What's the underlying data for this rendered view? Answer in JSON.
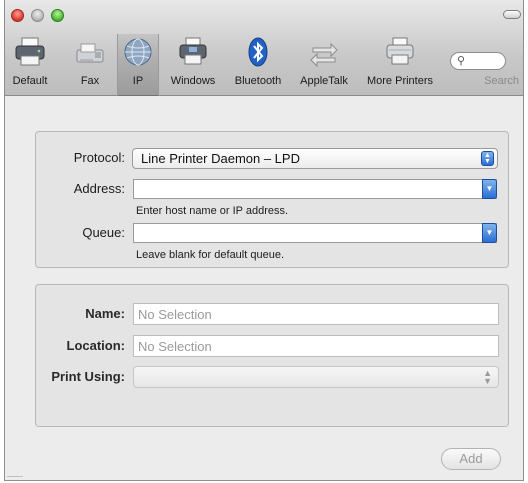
{
  "toolbar": {
    "items": [
      {
        "label": "Default",
        "icon": "default-printer-icon"
      },
      {
        "label": "Fax",
        "icon": "fax-icon"
      },
      {
        "label": "IP",
        "icon": "ip-globe-icon",
        "selected": true
      },
      {
        "label": "Windows",
        "icon": "windows-printer-icon"
      },
      {
        "label": "Bluetooth",
        "icon": "bluetooth-icon"
      },
      {
        "label": "AppleTalk",
        "icon": "appletalk-icon"
      },
      {
        "label": "More Printers",
        "icon": "more-printers-icon"
      }
    ],
    "search_label": "Search",
    "search_icon": "magnifier-icon"
  },
  "connection": {
    "protocol_label": "Protocol:",
    "protocol_value": "Line Printer Daemon – LPD",
    "address_label": "Address:",
    "address_value": "",
    "address_hint": "Enter host name or IP address.",
    "queue_label": "Queue:",
    "queue_value": "",
    "queue_hint": "Leave blank for default queue."
  },
  "details": {
    "name_label": "Name:",
    "name_placeholder": "No Selection",
    "location_label": "Location:",
    "location_placeholder": "No Selection",
    "print_using_label": "Print Using:",
    "print_using_value": ""
  },
  "actions": {
    "add_label": "Add"
  },
  "colors": {
    "accent": "#2b6fd6",
    "close": "#e0443a",
    "minimize": "#bcbcbc",
    "zoom": "#57be3a"
  }
}
